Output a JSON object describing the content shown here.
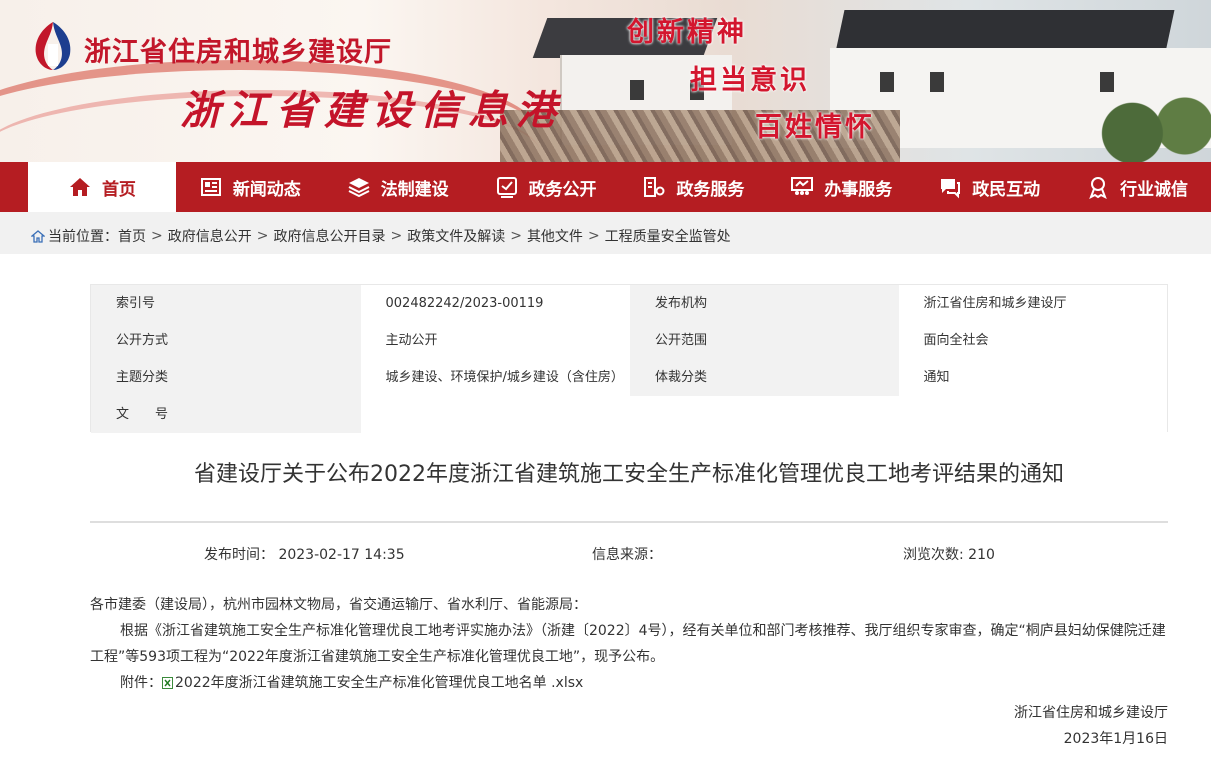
{
  "header": {
    "org_name": "浙江省住房和城乡建设厅",
    "site_name": "浙江省建设信息港",
    "slogans": [
      "创新精神",
      "担当意识",
      "百姓情怀"
    ]
  },
  "nav": {
    "items": [
      {
        "label": "首页",
        "icon": "home-icon"
      },
      {
        "label": "新闻动态",
        "icon": "newspaper-icon"
      },
      {
        "label": "法制建设",
        "icon": "layers-icon"
      },
      {
        "label": "政务公开",
        "icon": "approval-icon"
      },
      {
        "label": "政务服务",
        "icon": "server-gear-icon"
      },
      {
        "label": "办事服务",
        "icon": "meeting-icon"
      },
      {
        "label": "政民互动",
        "icon": "chat-icon"
      },
      {
        "label": "行业诚信",
        "icon": "award-icon"
      }
    ]
  },
  "breadcrumb": {
    "prefix": "当前位置：",
    "items": [
      "首页",
      "政府信息公开",
      "政府信息公开目录",
      "政策文件及解读",
      "其他文件",
      "工程质量安全监管处"
    ]
  },
  "info": {
    "rows": [
      {
        "l1": "索引号",
        "v1": "002482242/2023-00119",
        "l2": "发布机构",
        "v2": "浙江省住房和城乡建设厅"
      },
      {
        "l1": "公开方式",
        "v1": "主动公开",
        "l2": "公开范围",
        "v2": "面向全社会"
      },
      {
        "l1": "主题分类",
        "v1": "城乡建设、环境保护/城乡建设（含住房）",
        "l2": "体裁分类",
        "v2": "通知"
      },
      {
        "l1": "文　　号",
        "v1": "",
        "l2": "",
        "v2": ""
      }
    ]
  },
  "article": {
    "title": "省建设厅关于公布2022年度浙江省建筑施工安全生产标准化管理优良工地考评结果的通知",
    "publish_label": "发布时间： 2023-02-17 14:35",
    "source_label": "信息来源：",
    "views_label": "浏览次数: 210",
    "salutation": "各市建委（建设局），杭州市园林文物局，省交通运输厅、省水利厅、省能源局：",
    "paragraph": "根据《浙江省建筑施工安全生产标准化管理优良工地考评实施办法》（浙建〔2022〕4号），经有关单位和部门考核推荐、我厅组织专家审查，确定“桐庐县妇幼保健院迁建工程”等593项工程为“2022年度浙江省建筑施工安全生产标准化管理优良工地”，现予公布。",
    "attachment_label": "附件：",
    "attachment_name": "2022年度浙江省建筑施工安全生产标准化管理优良工地名单 .xlsx",
    "signature": "浙江省住房和城乡建设厅",
    "date": "2023年1月16日"
  },
  "colors": {
    "nav_red": "#b51d22",
    "title_red": "#c2172a"
  }
}
